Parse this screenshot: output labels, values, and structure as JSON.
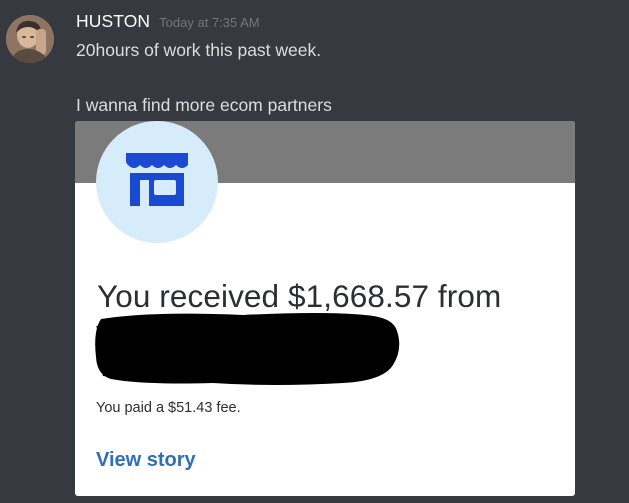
{
  "message": {
    "author": "HUSTON",
    "timestamp": "Today at 7:35 AM",
    "lines": [
      "20hours of work this past week.",
      "I wanna find more ecom partners"
    ],
    "avatar_icon": "user-avatar"
  },
  "attachment": {
    "store_icon": "storefront-icon",
    "received_text": "You received $1,668.57 from",
    "fee_text": "You paid a $51.43 fee.",
    "link_label": "View story",
    "colors": {
      "banner": "#7b7b7b",
      "icon_circle": "#d6ecfb",
      "icon": "#1b4ad2",
      "link": "#2f6fb7"
    }
  }
}
